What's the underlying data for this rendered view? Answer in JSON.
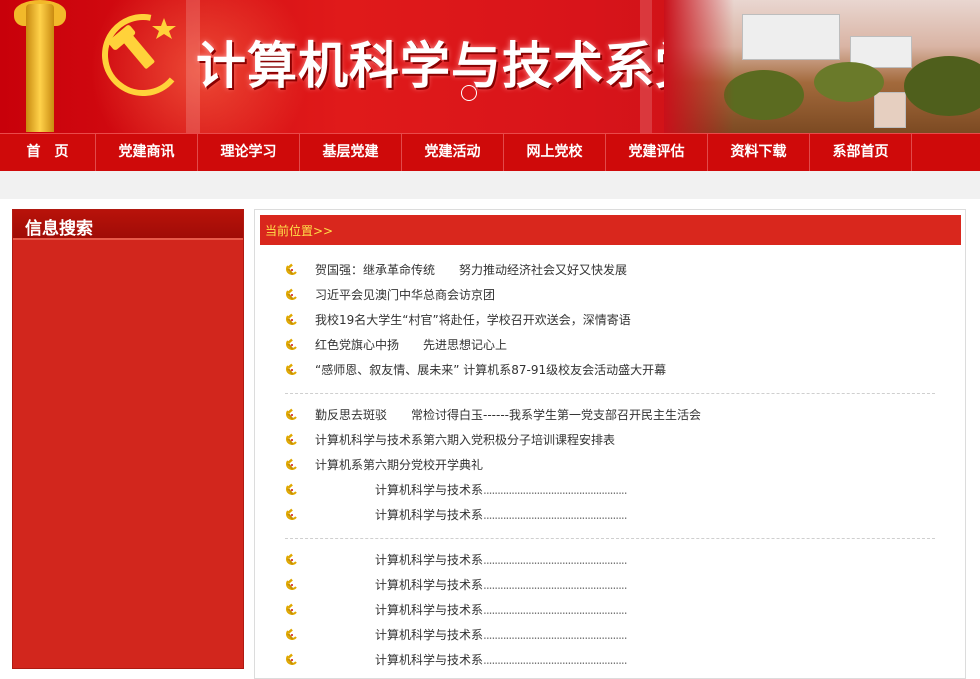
{
  "site": {
    "title": "计算机科学与技术系党建网"
  },
  "nav": {
    "items": [
      "首　页",
      "党建商讯",
      "理论学习",
      "基层党建",
      "党建活动",
      "网上党校",
      "党建评估",
      "资料下载",
      "系部首页"
    ]
  },
  "sidebar": {
    "title": "信息搜索"
  },
  "main": {
    "breadcrumb": "当前位置>>",
    "group1": [
      "贺国强：继承革命传统　　努力推动经济社会又好又快发展",
      "习近平会见澳门中华总商会访京团",
      "我校19名大学生“村官”将赴任，学校召开欢送会，深情寄语",
      "红色党旗心中扬　　先进思想记心上",
      "“感师恩、叙友情、展未来” 计算机系87-91级校友会活动盛大开幕"
    ],
    "group2": [
      "勤反思去斑驳　　常检讨得白玉------我系学生第一党支部召开民主生活会",
      "计算机科学与技术系第六期入党积极分子培训课程安排表",
      "计算机系第六期分党校开学典礼",
      "　　　　　计算机科学与技术系",
      "　　　　　计算机科学与技术系"
    ],
    "group3": [
      "　　　　　计算机科学与技术系",
      "　　　　　计算机科学与技术系",
      "　　　　　计算机科学与技术系",
      "　　　　　计算机科学与技术系",
      "　　　　　计算机科学与技术系"
    ],
    "leader_dots": "..................................................."
  },
  "colors": {
    "primary_red": "#cf0a0a",
    "breadcrumb_text": "#ffe04a"
  },
  "icons": {
    "list_bullet": "hammer-sickle-icon"
  }
}
